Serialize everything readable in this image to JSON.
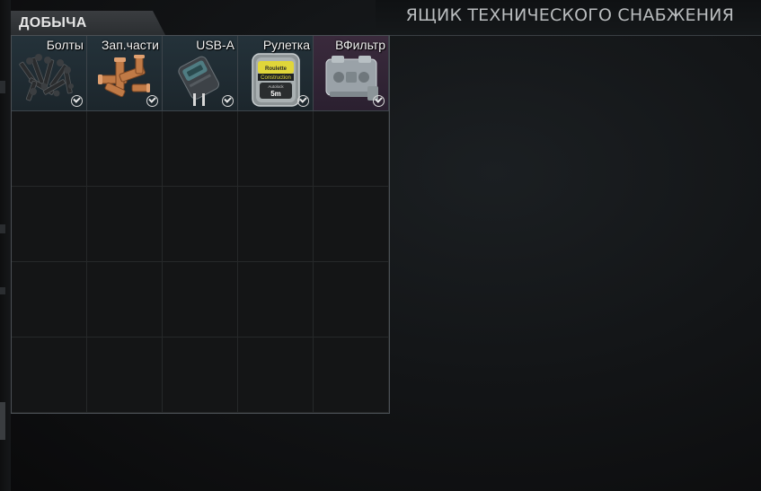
{
  "header": {
    "loot_title": "ДОБЫЧА",
    "container_title": "ЯЩИК ТЕХНИЧЕСКОГО СНАБЖЕНИЯ"
  },
  "items": [
    {
      "label": "Болты",
      "icon": "bolts-icon",
      "rarity_color": "#1f2b32",
      "found_in_raid": true
    },
    {
      "label": "Зап.части",
      "icon": "copper-fittings-icon",
      "rarity_color": "#1f2b32",
      "found_in_raid": true
    },
    {
      "label": "USB-A",
      "icon": "usb-adapter-icon",
      "rarity_color": "#1f2b32",
      "found_in_raid": true
    },
    {
      "label": "Рулетка",
      "icon": "tape-measure-icon",
      "rarity_color": "#1f2b32",
      "found_in_raid": true
    },
    {
      "label": "ВФильтр",
      "icon": "air-filter-icon",
      "rarity_color": "#33263a",
      "found_in_raid": true
    }
  ],
  "tape_measure": {
    "brand": "Roulette",
    "model": "Construction",
    "sub": "Autolock",
    "length": "5m"
  },
  "grid": {
    "columns": 5,
    "rows": 5
  }
}
